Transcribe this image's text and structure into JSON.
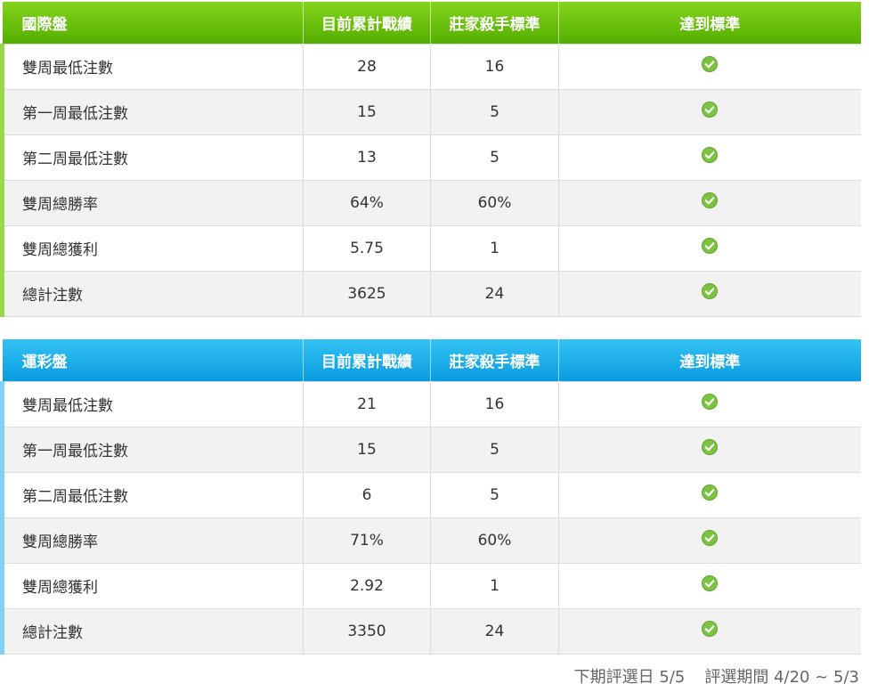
{
  "boards": [
    {
      "columns": [
        "國際盤",
        "目前累計戰績",
        "莊家殺手標準",
        "達到標準"
      ],
      "rows": [
        {
          "label": "雙周最低注數",
          "current": "28",
          "standard": "16",
          "met": "check-icon"
        },
        {
          "label": "第一周最低注數",
          "current": "15",
          "standard": "5",
          "met": "check-icon"
        },
        {
          "label": "第二周最低注數",
          "current": "13",
          "standard": "5",
          "met": "check-icon"
        },
        {
          "label": "雙周總勝率",
          "current": "64%",
          "standard": "60%",
          "met": "check-icon"
        },
        {
          "label": "雙周總獲利",
          "current": "5.75",
          "standard": "1",
          "met": "check-icon"
        },
        {
          "label": "總計注數",
          "current": "3625",
          "standard": "24",
          "met": "check-icon"
        }
      ]
    },
    {
      "columns": [
        "運彩盤",
        "目前累計戰績",
        "莊家殺手標準",
        "達到標準"
      ],
      "rows": [
        {
          "label": "雙周最低注數",
          "current": "21",
          "standard": "16",
          "met": "check-icon"
        },
        {
          "label": "第一周最低注數",
          "current": "15",
          "standard": "5",
          "met": "check-icon"
        },
        {
          "label": "第二周最低注數",
          "current": "6",
          "standard": "5",
          "met": "check-icon"
        },
        {
          "label": "雙周總勝率",
          "current": "71%",
          "standard": "60%",
          "met": "check-icon"
        },
        {
          "label": "雙周總獲利",
          "current": "2.92",
          "standard": "1",
          "met": "check-icon"
        },
        {
          "label": "總計注數",
          "current": "3350",
          "standard": "24",
          "met": "check-icon"
        }
      ]
    }
  ],
  "footer": {
    "next_date": "下期評選日 5/5",
    "period": "評選期間 4/20 ~ 5/3"
  },
  "colors": {
    "check_fill": "#7cc341",
    "intl_header": "#5cb300",
    "lottery_header": "#129fe2"
  }
}
